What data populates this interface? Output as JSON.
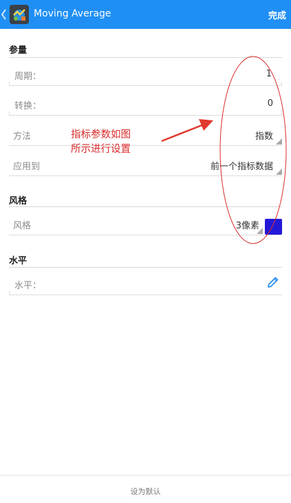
{
  "header": {
    "title": "Moving Average",
    "done_label": "完成",
    "back_icon": "chevron-left-icon",
    "app_icon": "app-logo-icon",
    "bar_color": "#1f8ff5"
  },
  "sections": {
    "params": {
      "title": "参量",
      "period": {
        "label": "周期：",
        "value": "1"
      },
      "shift": {
        "label": "转换：",
        "value": "0"
      },
      "method": {
        "label": "方法",
        "value": "指数"
      },
      "apply_to": {
        "label": "应用到",
        "value": "前一个指标数据"
      }
    },
    "style": {
      "title": "风格",
      "style_row": {
        "label": "风格",
        "value": "3像素",
        "swatch_color": "#2418d8"
      }
    },
    "levels": {
      "title": "水平",
      "level_row": {
        "label": "水平：",
        "edit_icon": "pencil-icon"
      }
    }
  },
  "annotation": {
    "line1": "指标参数如图",
    "line2": "所示进行设置",
    "color": "#d92b2b"
  },
  "footer": {
    "set_default_label": "设为默认"
  }
}
